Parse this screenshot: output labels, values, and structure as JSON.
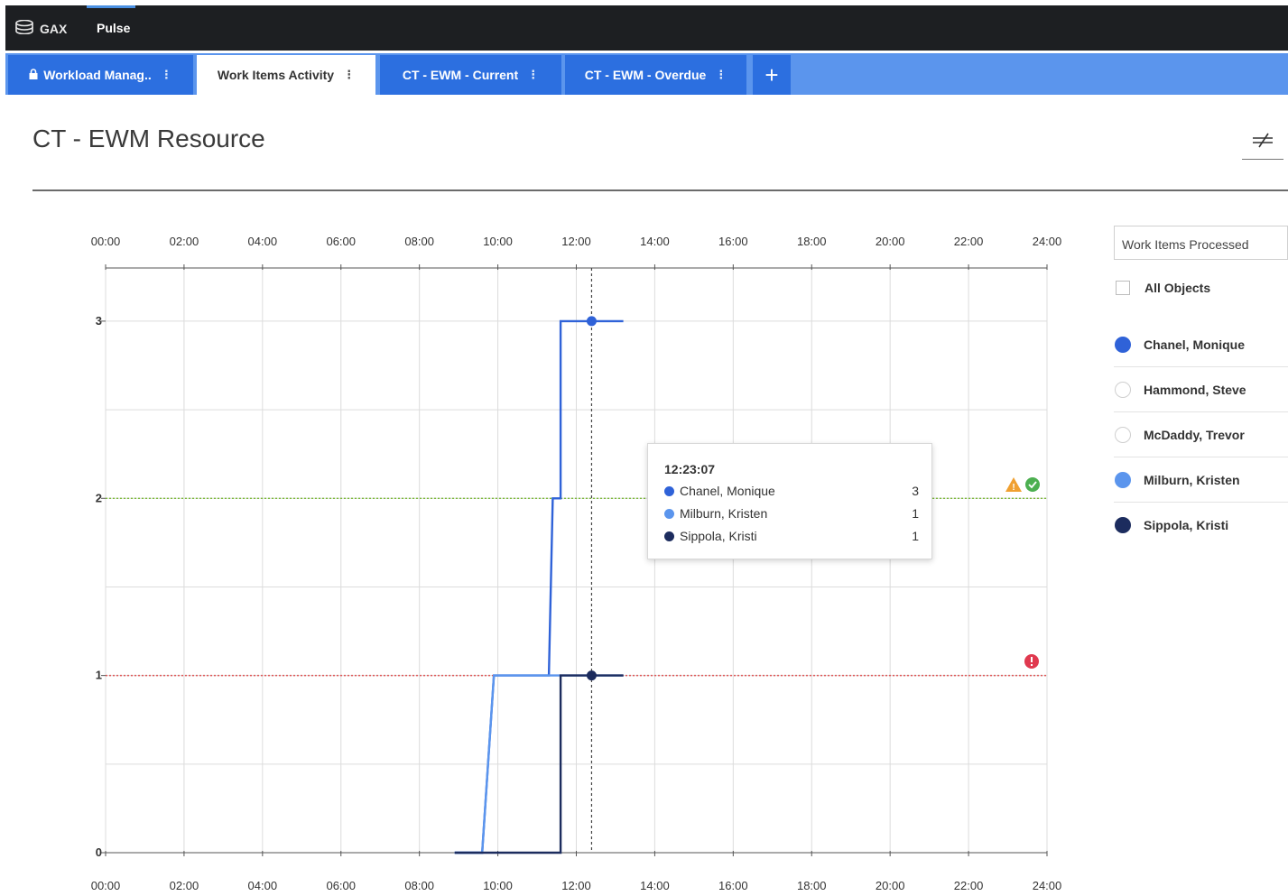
{
  "app": {
    "logo_label": "GAX",
    "nav_active": "Pulse"
  },
  "tabs": [
    {
      "label": "Workload Manag..",
      "locked": true,
      "active": false
    },
    {
      "label": "Work Items Activity",
      "active": true
    },
    {
      "label": "CT - EWM - Current",
      "active": false
    },
    {
      "label": "CT - EWM - Overdue",
      "active": false
    }
  ],
  "add_tab_label": "+",
  "tab_menu_glyph": "⋮",
  "page": {
    "title": "CT - EWM Resource"
  },
  "selector": {
    "value": "Work Items Processed"
  },
  "legend": {
    "all_objects_label": "All Objects",
    "items": [
      {
        "name": "Chanel, Monique",
        "color": "#2f62d8",
        "enabled": true
      },
      {
        "name": "Hammond, Steve",
        "color": "#ffffff",
        "enabled": false
      },
      {
        "name": "McDaddy, Trevor",
        "color": "#ffffff",
        "enabled": false
      },
      {
        "name": "Milburn, Kristen",
        "color": "#5b95ed",
        "enabled": true
      },
      {
        "name": "Sippola, Kristi",
        "color": "#1c2c5e",
        "enabled": true
      }
    ]
  },
  "tooltip": {
    "time": "12:23:07",
    "rows": [
      {
        "name": "Chanel, Monique",
        "value": "3",
        "color": "#2f62d8"
      },
      {
        "name": "Milburn, Kristen",
        "value": "1",
        "color": "#5b95ed"
      },
      {
        "name": "Sippola, Kristi",
        "value": "1",
        "color": "#1c2c5e"
      }
    ]
  },
  "chart_data": {
    "type": "line",
    "step": true,
    "x_ticks": [
      "00:00",
      "02:00",
      "04:00",
      "06:00",
      "08:00",
      "10:00",
      "12:00",
      "14:00",
      "16:00",
      "18:00",
      "20:00",
      "22:00",
      "24:00"
    ],
    "y_ticks": [
      0,
      1,
      2,
      3
    ],
    "xlim": [
      0,
      24
    ],
    "ylim": [
      0,
      3.3
    ],
    "grid": true,
    "cursor_x": 12.39,
    "thresholds": [
      {
        "value": 2,
        "color": "#7cbb3a",
        "icons": [
          "warning-icon",
          "ok-icon"
        ]
      },
      {
        "value": 1,
        "color": "#e05858",
        "icons": [
          "error-icon"
        ]
      }
    ],
    "series": [
      {
        "name": "Chanel, Monique",
        "color": "#2f62d8",
        "points": [
          [
            8.9,
            0
          ],
          [
            9.6,
            0
          ],
          [
            9.9,
            1
          ],
          [
            11.3,
            1
          ],
          [
            11.4,
            2
          ],
          [
            11.6,
            2
          ],
          [
            11.6,
            3
          ],
          [
            13.2,
            3
          ]
        ]
      },
      {
        "name": "Milburn, Kristen",
        "color": "#5b95ed",
        "points": [
          [
            8.9,
            0
          ],
          [
            9.6,
            0
          ],
          [
            9.9,
            1
          ],
          [
            13.2,
            1
          ]
        ]
      },
      {
        "name": "Sippola, Kristi",
        "color": "#1c2c5e",
        "points": [
          [
            8.9,
            0
          ],
          [
            11.6,
            0
          ],
          [
            11.6,
            1
          ],
          [
            13.2,
            1
          ]
        ]
      }
    ],
    "markers": [
      {
        "series": "Chanel, Monique",
        "x": 12.39,
        "y": 3
      },
      {
        "series": "Sippola, Kristi",
        "x": 12.39,
        "y": 1
      }
    ]
  }
}
